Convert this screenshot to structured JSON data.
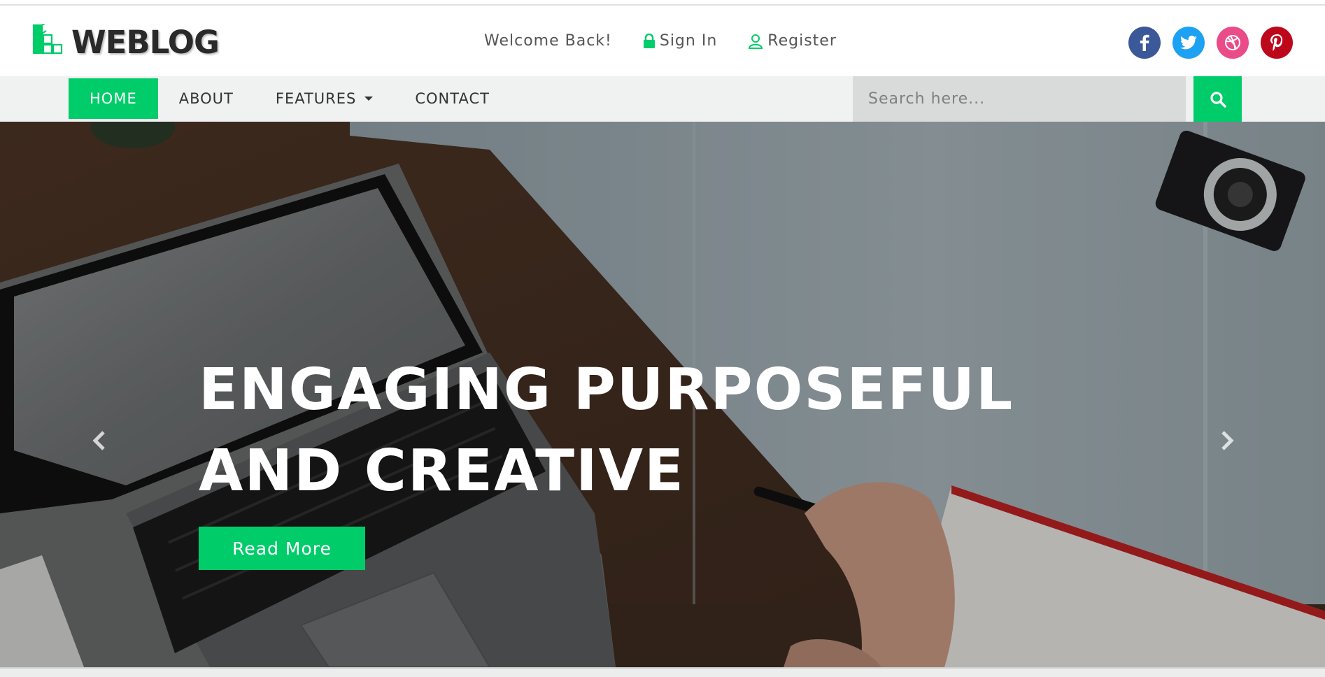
{
  "brand": {
    "name": "WEBLOG",
    "accent": "#00cc6a"
  },
  "top_bar": {
    "welcome": "Welcome Back!",
    "sign_in": "Sign In",
    "register": "Register"
  },
  "social": [
    {
      "name": "facebook",
      "glyph": "f",
      "color": "#3b5998"
    },
    {
      "name": "twitter",
      "glyph": "t",
      "color": "#1da1f2"
    },
    {
      "name": "dribbble",
      "glyph": "d",
      "color": "#ea4c89"
    },
    {
      "name": "pinterest",
      "glyph": "p",
      "color": "#bd081c"
    }
  ],
  "nav": {
    "home": "HOME",
    "about": "ABOUT",
    "features": "FEATURES",
    "contact": "CONTACT",
    "search_placeholder": "Search here..."
  },
  "hero": {
    "title_line1": "ENGAGING PURPOSEFUL",
    "title_line2": "AND CREATIVE",
    "cta": "Read More"
  }
}
